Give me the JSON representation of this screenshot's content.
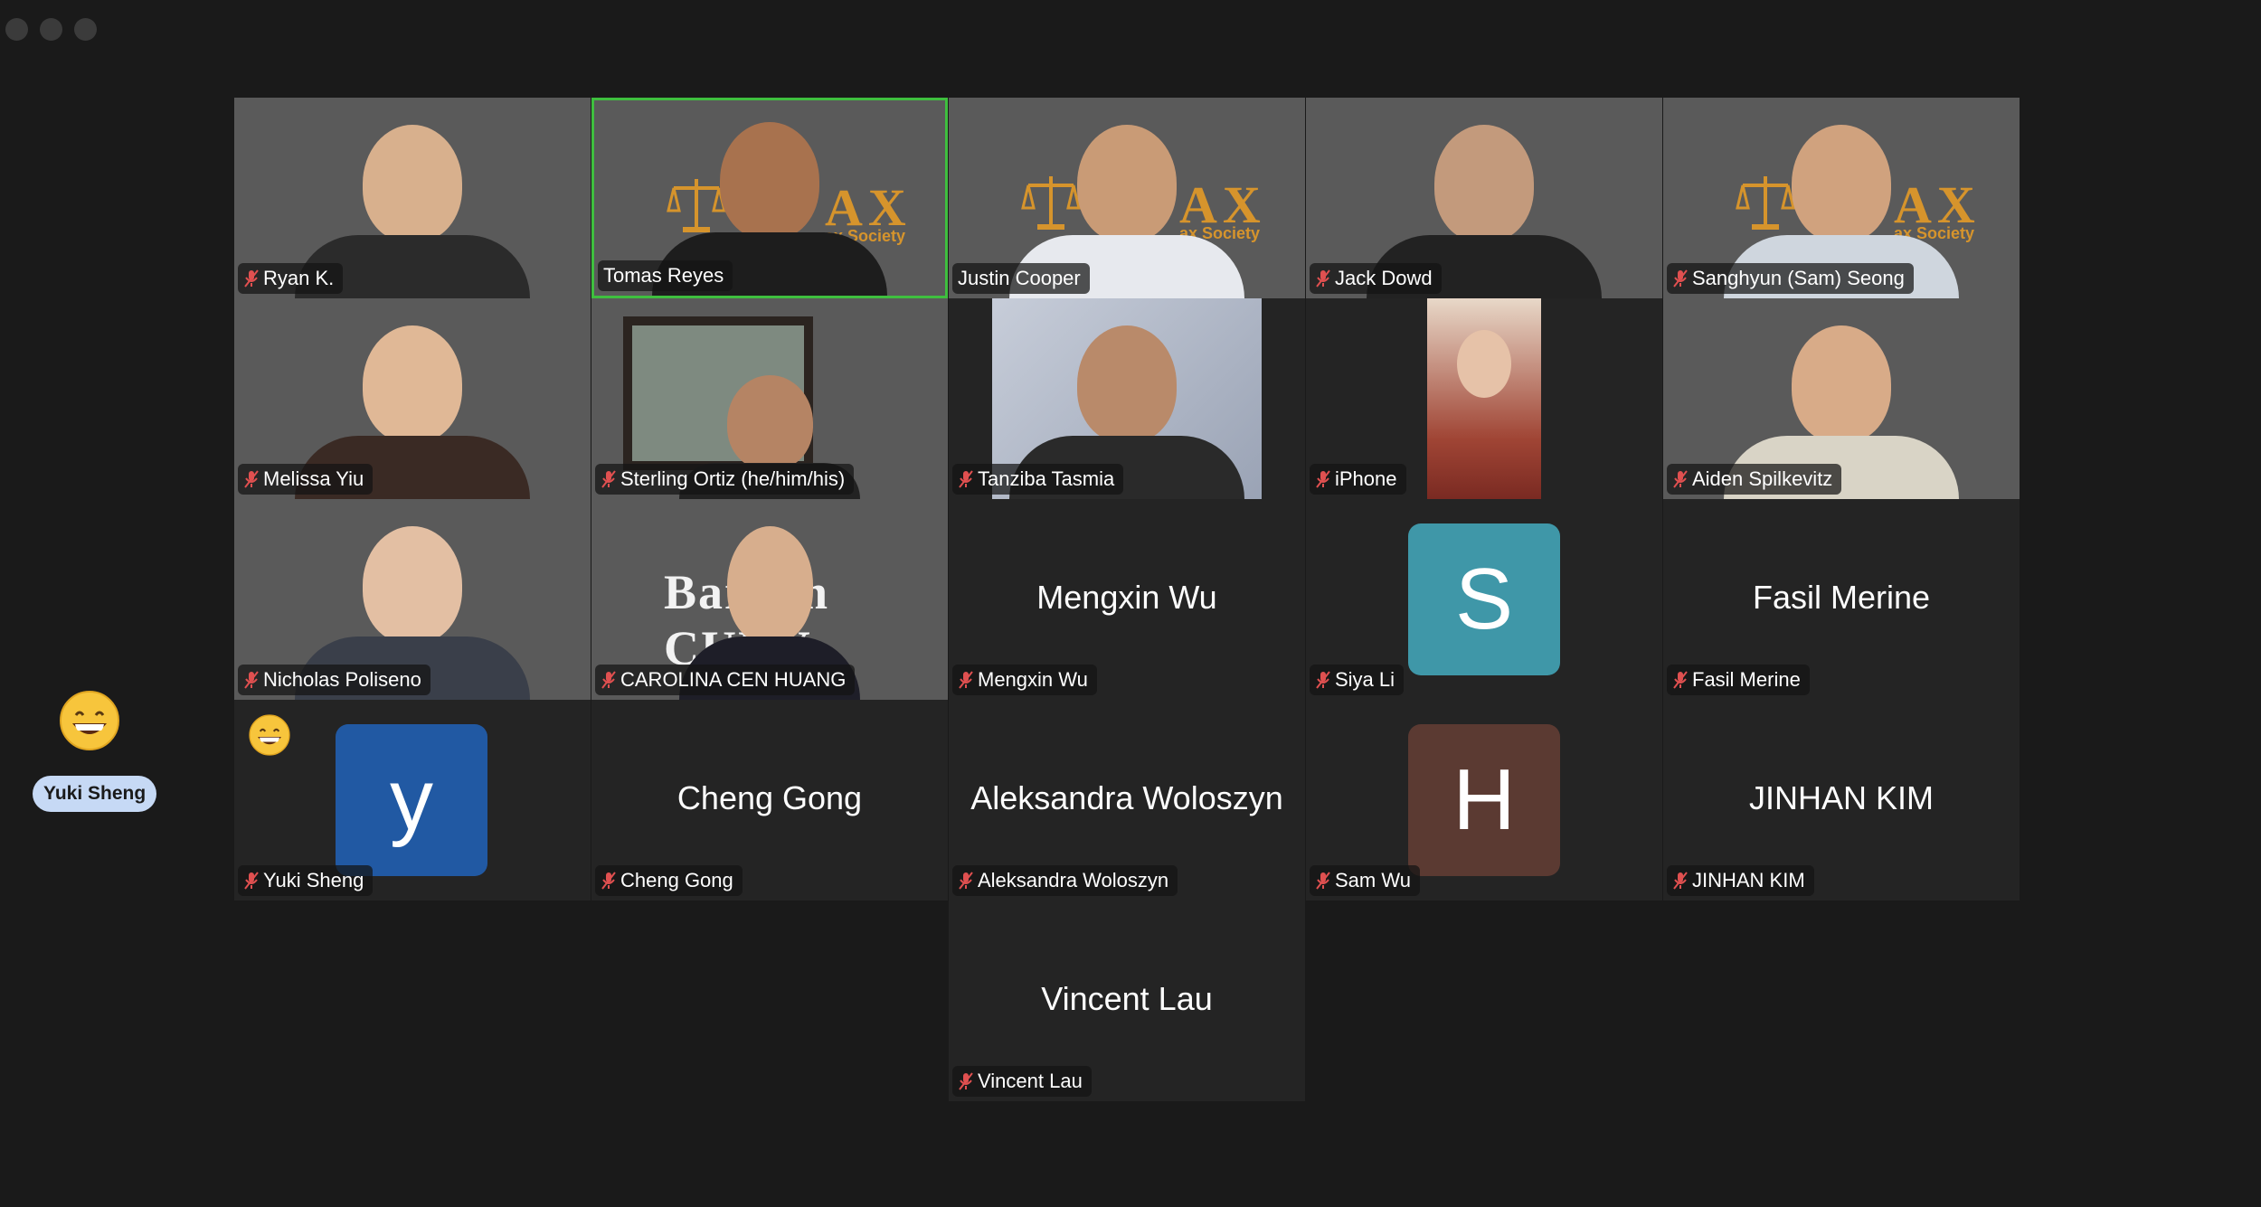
{
  "window": {
    "title": ""
  },
  "side_panel": {
    "label": "Yuki Sheng",
    "emoji": "grinning-face-emoji"
  },
  "participants": [
    {
      "name": "Ryan K.",
      "type": "video",
      "muted": true
    },
    {
      "name": "Tomas Reyes",
      "type": "video",
      "muted": false,
      "active_speaker": true,
      "logo_text": "AX",
      "logo_sub": "ax Society"
    },
    {
      "name": "Justin Cooper",
      "type": "video",
      "muted": false,
      "logo_text": "AX",
      "logo_sub": "ax Society"
    },
    {
      "name": "Jack Dowd",
      "type": "video",
      "muted": true
    },
    {
      "name": "Sanghyun (Sam) Seong",
      "type": "video",
      "muted": true,
      "logo_text": "AX",
      "logo_sub": "ax Society"
    },
    {
      "name": "Melissa Yiu",
      "type": "video",
      "muted": true
    },
    {
      "name": "Sterling Ortiz (he/him/his)",
      "type": "video",
      "muted": true
    },
    {
      "name": "Tanziba Tasmia",
      "type": "video",
      "muted": true
    },
    {
      "name": "iPhone",
      "type": "video",
      "muted": true
    },
    {
      "name": "Aiden Spilkevitz",
      "type": "video",
      "muted": true
    },
    {
      "name": "Nicholas Poliseno",
      "type": "video",
      "muted": true
    },
    {
      "name": "CAROLINA CEN HUANG",
      "type": "video",
      "muted": true,
      "background_text": "Baruch CUNY"
    },
    {
      "name": "Mengxin Wu",
      "type": "name",
      "muted": true,
      "display": "Mengxin Wu"
    },
    {
      "name": "Siya Li",
      "type": "avatar",
      "muted": true,
      "initial": "S",
      "color": "#3f97a8"
    },
    {
      "name": "Fasil Merine",
      "type": "name",
      "muted": true,
      "display": "Fasil Merine"
    },
    {
      "name": "Yuki Sheng",
      "type": "avatar",
      "muted": true,
      "initial": "y",
      "color": "#2159a3",
      "reaction": "grinning-face-emoji"
    },
    {
      "name": "Cheng Gong",
      "type": "name",
      "muted": true,
      "display": "Cheng Gong"
    },
    {
      "name": "Aleksandra Woloszyn",
      "type": "name",
      "muted": true,
      "display": "Aleksandra Woloszyn"
    },
    {
      "name": "Sam Wu",
      "type": "avatar",
      "muted": true,
      "initial": "H",
      "color": "#5b3a32"
    },
    {
      "name": "JINHAN KIM",
      "type": "name",
      "muted": true,
      "display": "JINHAN KIM"
    },
    {
      "name": "Vincent Lau",
      "type": "name",
      "muted": true,
      "display": "Vincent Lau"
    }
  ]
}
